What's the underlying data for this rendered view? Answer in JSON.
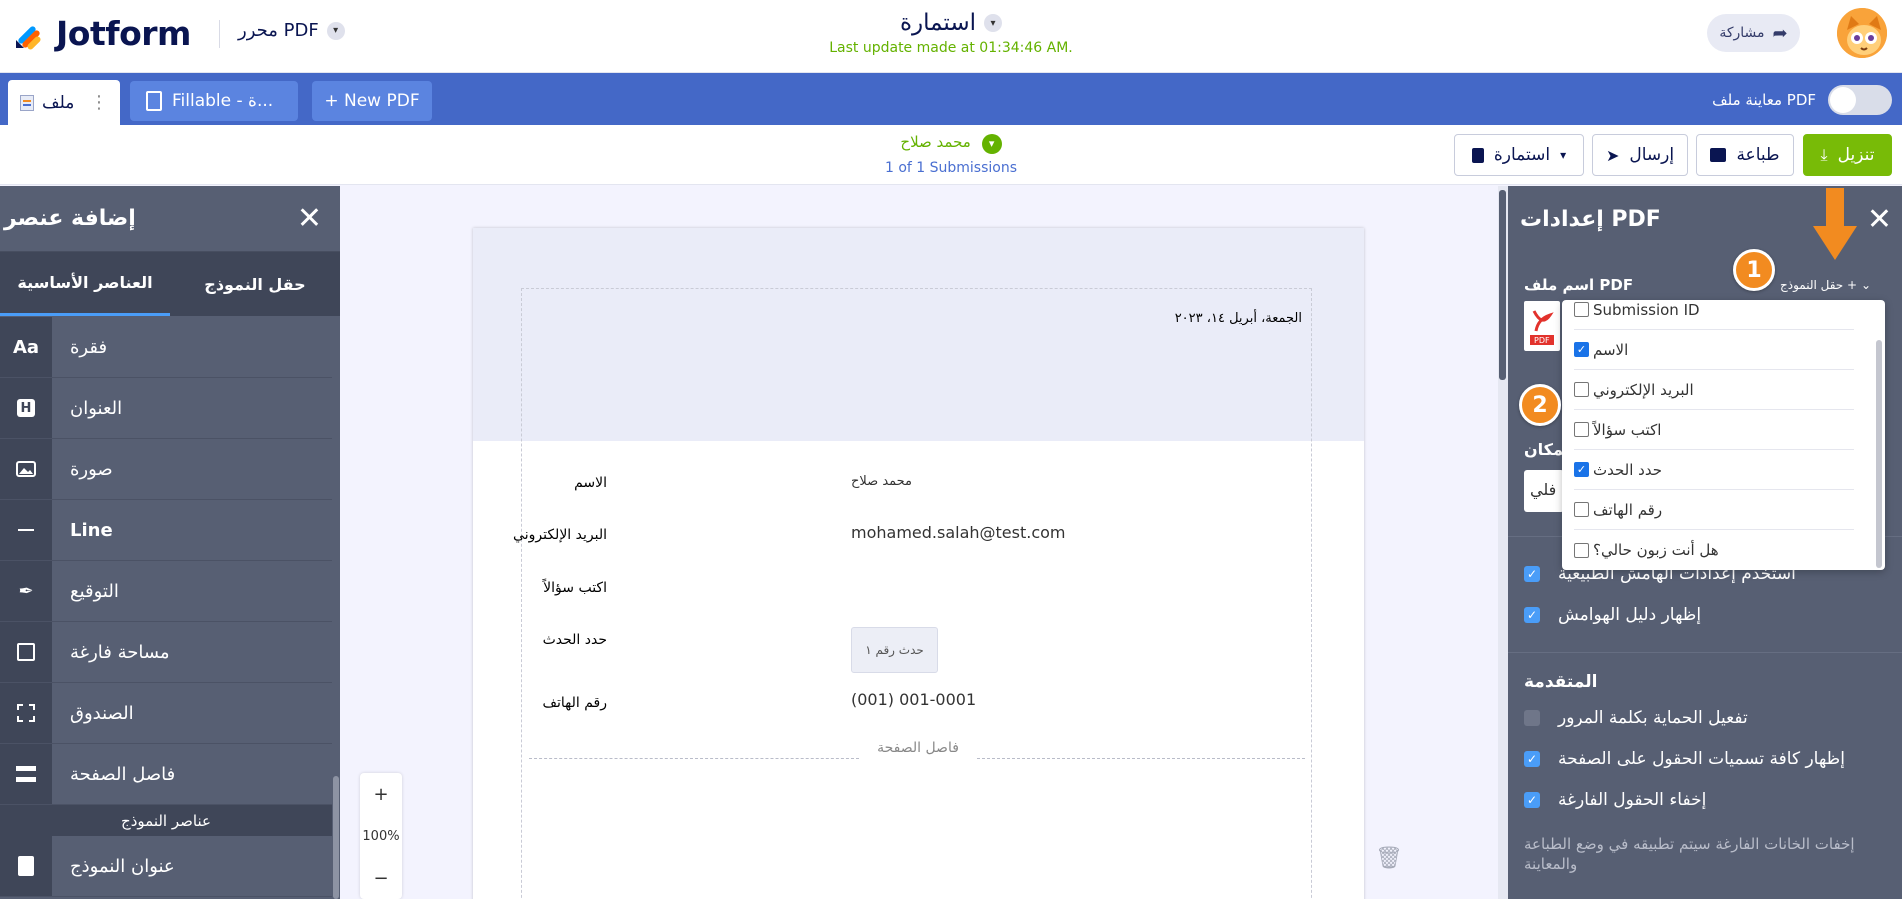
{
  "header": {
    "logo_text": "Jotform",
    "pdf_editor": "محرر PDF",
    "form_title": "استمارة",
    "last_update": "Last update made at 01:34:46 AM.",
    "share": "مشاركة"
  },
  "tabs": {
    "file": "ملف",
    "fillable": "Fillable - ة...",
    "new_pdf": "+ New PDF",
    "preview_toggle": "معاينة ملف PDF"
  },
  "toolbar": {
    "download": "تنزيل",
    "print": "طباعة",
    "send": "إرسال",
    "form": "استمارة",
    "submitter": "محمد صلاح",
    "submission_count": "1 of 1 Submissions"
  },
  "left_panel": {
    "title": "إضافة عنصر",
    "tab_basic": "العناصر الأساسية",
    "tab_form_field": "حقل النموذج",
    "items": [
      {
        "icon": "Aa",
        "label": "فقرة"
      },
      {
        "icon": "H",
        "label": "العنوان"
      },
      {
        "icon": "image",
        "label": "صورة"
      },
      {
        "icon": "line",
        "label": "Line"
      },
      {
        "icon": "pen",
        "label": "التوقيع"
      },
      {
        "icon": "square",
        "label": "مساحة فارغة"
      },
      {
        "icon": "box",
        "label": "الصندوق"
      },
      {
        "icon": "page-break",
        "label": "فاصل الصفحة"
      }
    ],
    "section_form_elements": "عناصر النموذج",
    "form_items": [
      {
        "icon": "contact",
        "label": "عنوان النموذج"
      }
    ]
  },
  "document": {
    "date": "الجمعة، أبريل ١٤، ٢٠٢٣",
    "rows": [
      {
        "label": "الاسم",
        "value": "محمد صلاح"
      },
      {
        "label": "البريد الإلكتروني",
        "value": "mohamed.salah@test.com"
      },
      {
        "label": "اكتب سؤالاً",
        "value": ""
      },
      {
        "label": "حدد الحدث",
        "value": "حدث رقم ١"
      },
      {
        "label": "رقم الهاتف",
        "value": "(001) 001-0001"
      }
    ],
    "page_break_text": "فاصل الصفحة",
    "zoom_in": "+",
    "zoom_level": "100%",
    "zoom_out": "−"
  },
  "right_panel": {
    "title": "إعدادات PDF",
    "file_name_label": "اسم ملف PDF",
    "form_field_link": "حقل النموذج +",
    "place_label": "المكان",
    "place_value": "فلي",
    "checks": [
      {
        "label": "استخدم إعدادات الهامش الطبيعية",
        "checked": true
      },
      {
        "label": "إظهار دليل الهوامش",
        "checked": true
      }
    ],
    "advanced_title": "المتقدمة",
    "advanced": [
      {
        "label": "تفعيل الحماية بكلمة المرور",
        "checked": false
      },
      {
        "label": "إظهار كافة تسميات الحقول على الصفحة",
        "checked": true
      },
      {
        "label": "إخفاء الحقول الفارغة",
        "checked": true
      }
    ],
    "note": "إخفات الخانات الفارغة سيتم تطبيقه في وضع الطباعة والمعاينة"
  },
  "dropdown": {
    "options": [
      {
        "label": "Submission ID",
        "checked": false
      },
      {
        "label": "الاسم",
        "checked": true
      },
      {
        "label": "البريد الإلكتروني",
        "checked": false
      },
      {
        "label": "اكتب سؤالاً",
        "checked": false
      },
      {
        "label": "حدد الحدث",
        "checked": true
      },
      {
        "label": "رقم الهاتف",
        "checked": false
      },
      {
        "label": "هل أنت زبون حالي؟",
        "checked": false
      }
    ]
  },
  "annotations": {
    "badge1": "1",
    "badge2": "2",
    "accent": "#f28b20"
  },
  "colors": {
    "brand_navy": "#0a1551",
    "blue_bar": "#4468c7",
    "green": "#78bb07",
    "panel": "#575f73"
  }
}
